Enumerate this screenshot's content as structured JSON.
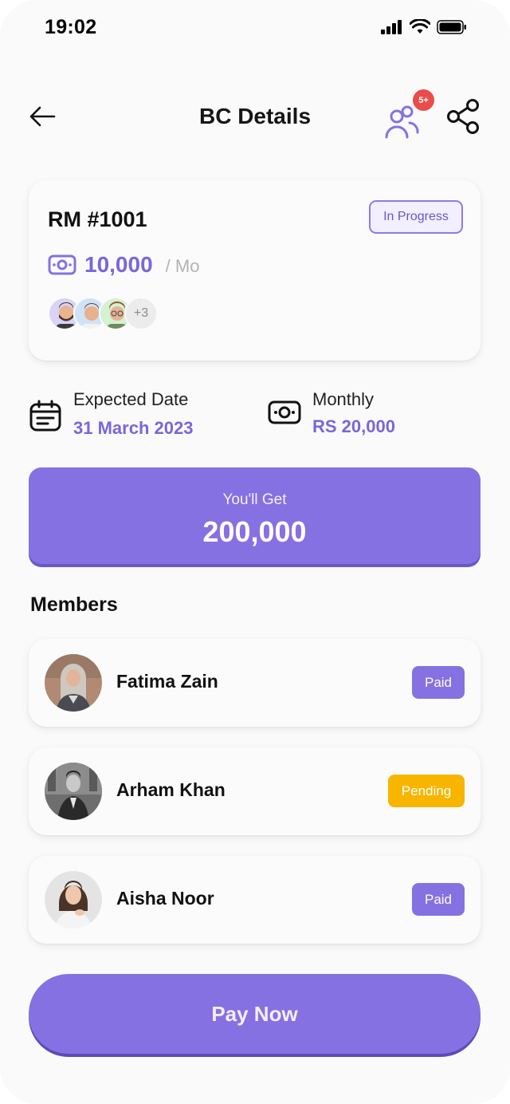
{
  "status_bar": {
    "time": "19:02"
  },
  "header": {
    "title": "BC Details",
    "notification_badge": "5+"
  },
  "summary": {
    "id": "RM #1001",
    "status": "In Progress",
    "amount": "10,000",
    "per": "/ Mo",
    "extra_members": "+3"
  },
  "info": {
    "expected_label": "Expected Date",
    "expected_value": "31 March 2023",
    "monthly_label": "Monthly",
    "monthly_value": "RS 20,000"
  },
  "payout": {
    "label": "You'll Get",
    "value": "200,000"
  },
  "members_section": {
    "title": "Members",
    "items": [
      {
        "name": "Fatima Zain",
        "status": "Paid"
      },
      {
        "name": "Arham Khan",
        "status": "Pending"
      },
      {
        "name": "Aisha Noor",
        "status": "Paid"
      }
    ]
  },
  "actions": {
    "pay_label": "Pay Now"
  },
  "colors": {
    "accent": "#8571e2",
    "pending": "#f7b500",
    "badge_red": "#ea4c4c"
  },
  "icons": [
    "back-arrow-icon",
    "members-group-icon",
    "share-icon",
    "money-icon",
    "calendar-icon",
    "signal-icon",
    "wifi-icon",
    "battery-icon"
  ]
}
